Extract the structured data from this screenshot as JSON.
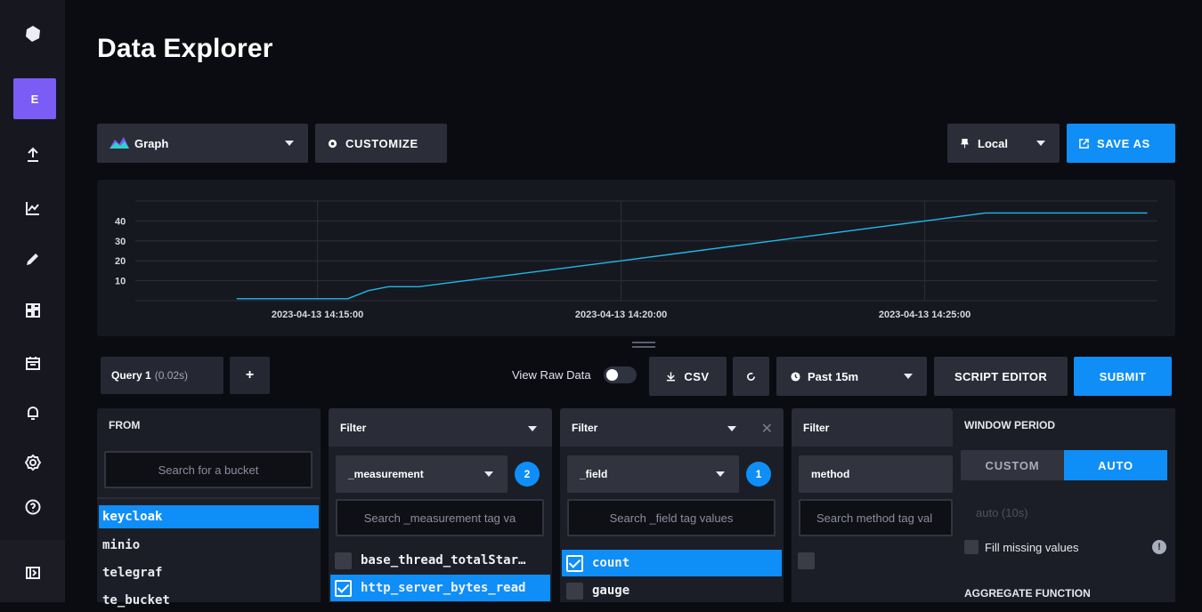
{
  "page": {
    "title": "Data Explorer"
  },
  "nav": {
    "user_initial": "E"
  },
  "toolbar": {
    "graph_label": "Graph",
    "customize_label": "CUSTOMIZE",
    "timezone_label": "Local",
    "save_as_label": "SAVE AS"
  },
  "chart_data": {
    "type": "line",
    "x_tick_labels": [
      "2023-04-13 14:15:00",
      "2023-04-13 14:20:00",
      "2023-04-13 14:25:00"
    ],
    "y_tick_labels": [
      "40",
      "30",
      "20",
      "10"
    ],
    "ylim": [
      0,
      50
    ],
    "series": [
      {
        "color": "#22b8e6",
        "x": [
          "14:13:40",
          "14:15:00",
          "14:15:30",
          "14:15:50",
          "14:16:10",
          "14:16:40",
          "14:20:00",
          "14:25:00",
          "14:26:00",
          "14:28:40"
        ],
        "values": [
          1,
          1,
          1,
          5,
          7,
          7,
          20,
          40,
          44,
          44
        ]
      }
    ],
    "grid": true
  },
  "query": {
    "tab_label": "Query 1",
    "tab_duration": "(0.02s)",
    "add_label": "+",
    "raw_data_label": "View Raw Data",
    "csv_label": "CSV",
    "time_range_label": "Past 15m",
    "script_editor_label": "SCRIPT EDITOR",
    "submit_label": "SUBMIT"
  },
  "from": {
    "title": "FROM",
    "search_placeholder": "Search for a bucket",
    "buckets": [
      "keycloak",
      "minio",
      "telegraf",
      "te_bucket"
    ],
    "selected": "keycloak"
  },
  "filters": [
    {
      "title": "Filter",
      "key": "_measurement",
      "count": "2",
      "search_placeholder": "Search _measurement tag va",
      "values": [
        "base_thread_totalStar…",
        "http_server_bytes_read"
      ],
      "selected": [
        false,
        true
      ]
    },
    {
      "title": "Filter",
      "key": "_field",
      "count": "1",
      "search_placeholder": "Search _field tag values",
      "values": [
        "count",
        "gauge"
      ],
      "selected": [
        true,
        false
      ]
    },
    {
      "title": "Filter",
      "key": "method",
      "search_placeholder": "Search method tag val",
      "values": [
        ""
      ],
      "selected": [
        false
      ]
    }
  ],
  "window_period": {
    "title": "WINDOW PERIOD",
    "custom_label": "CUSTOM",
    "auto_label": "AUTO",
    "auto_value": "auto (10s)",
    "fill_missing_label": "Fill missing values",
    "aggregate_title": "AGGREGATE FUNCTION"
  }
}
